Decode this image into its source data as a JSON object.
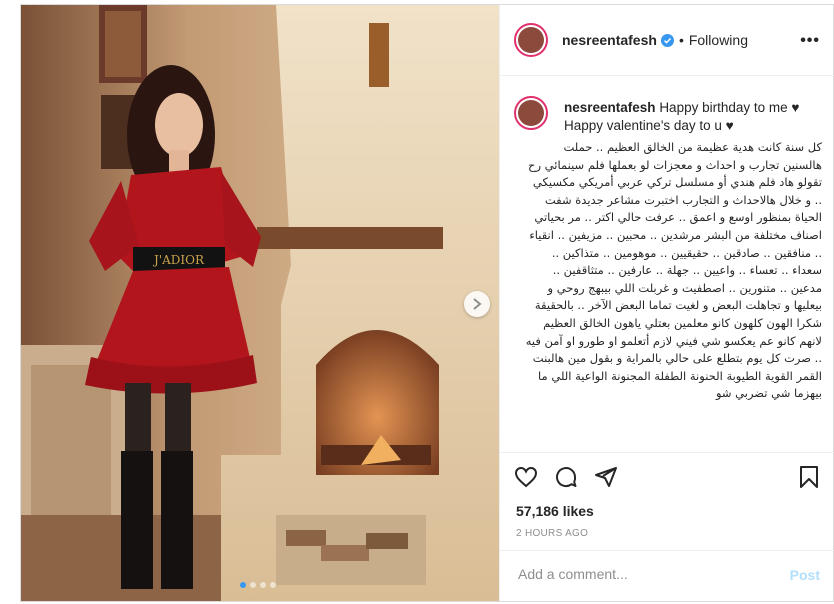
{
  "post": {
    "username": "nesreentafesh",
    "separator": "•",
    "follow_status": "Following",
    "more_icon": "•••",
    "caption_english": "Happy birthday to me ♥ Happy valentine's day to u ♥",
    "caption_arabic": "كل سنة كانت هدية عظيمة من الخالق العظيم .. حملت هالسنين تجارب و احداث و معجزات لو بعملها فلم سينمائي رح تقولو هاد فلم هندي أو مسلسل تركي عربي أمريكي مكسيكي .. و خلال هالاحداث و التجارب اختبرت مشاعر جديدة شفت الحياة بمنظور اوسع و اعمق .. عرفت حالي اكتر .. مر بحياتي اصناف مختلفة من البشر مرشدين .. محبين .. مزيفين .. انقياء .. منافقين .. صادقين .. حقيقيين .. موهومين .. متذاكين .. سعداء .. تعساء .. واعيين .. جهلة .. عارفين .. متثاقفين .. مدعين .. متنورين .. اصطفيت و غربلت اللي بيبهج روحي و بيعليها و تجاهلت البعض و لغيت تماما البعض الآخر .. بالحقيقة شكرا الهون كلهون كانو معلمين بعتلي ياهون الخالق العظيم لانهم كانو عم يعكسو شي فيني لازم أتعلمو او طورو او آمن فيه .. صرت كل يوم بتطلع على حالي بالمراية و بقول مين هالبنت القمر القوية الطيوبة الحنونة الطفلة المجنونة الواعية اللي ما بيهزما شي تضربي شو",
    "likes": "57,186 likes",
    "time": "2 HOURS AGO",
    "comment_placeholder": "Add a comment...",
    "post_button": "Post",
    "photo_belt_text": "J'ADIOR"
  },
  "colors": {
    "accent_blue": "#3897f0",
    "post_button_disabled": "#b2dffc",
    "dress_red": "#b3151d"
  },
  "icons": {
    "like": "heart-icon",
    "comment": "comment-icon",
    "share": "share-icon",
    "save": "bookmark-icon",
    "verified": "verified-badge-icon",
    "next": "chevron-right-icon"
  }
}
